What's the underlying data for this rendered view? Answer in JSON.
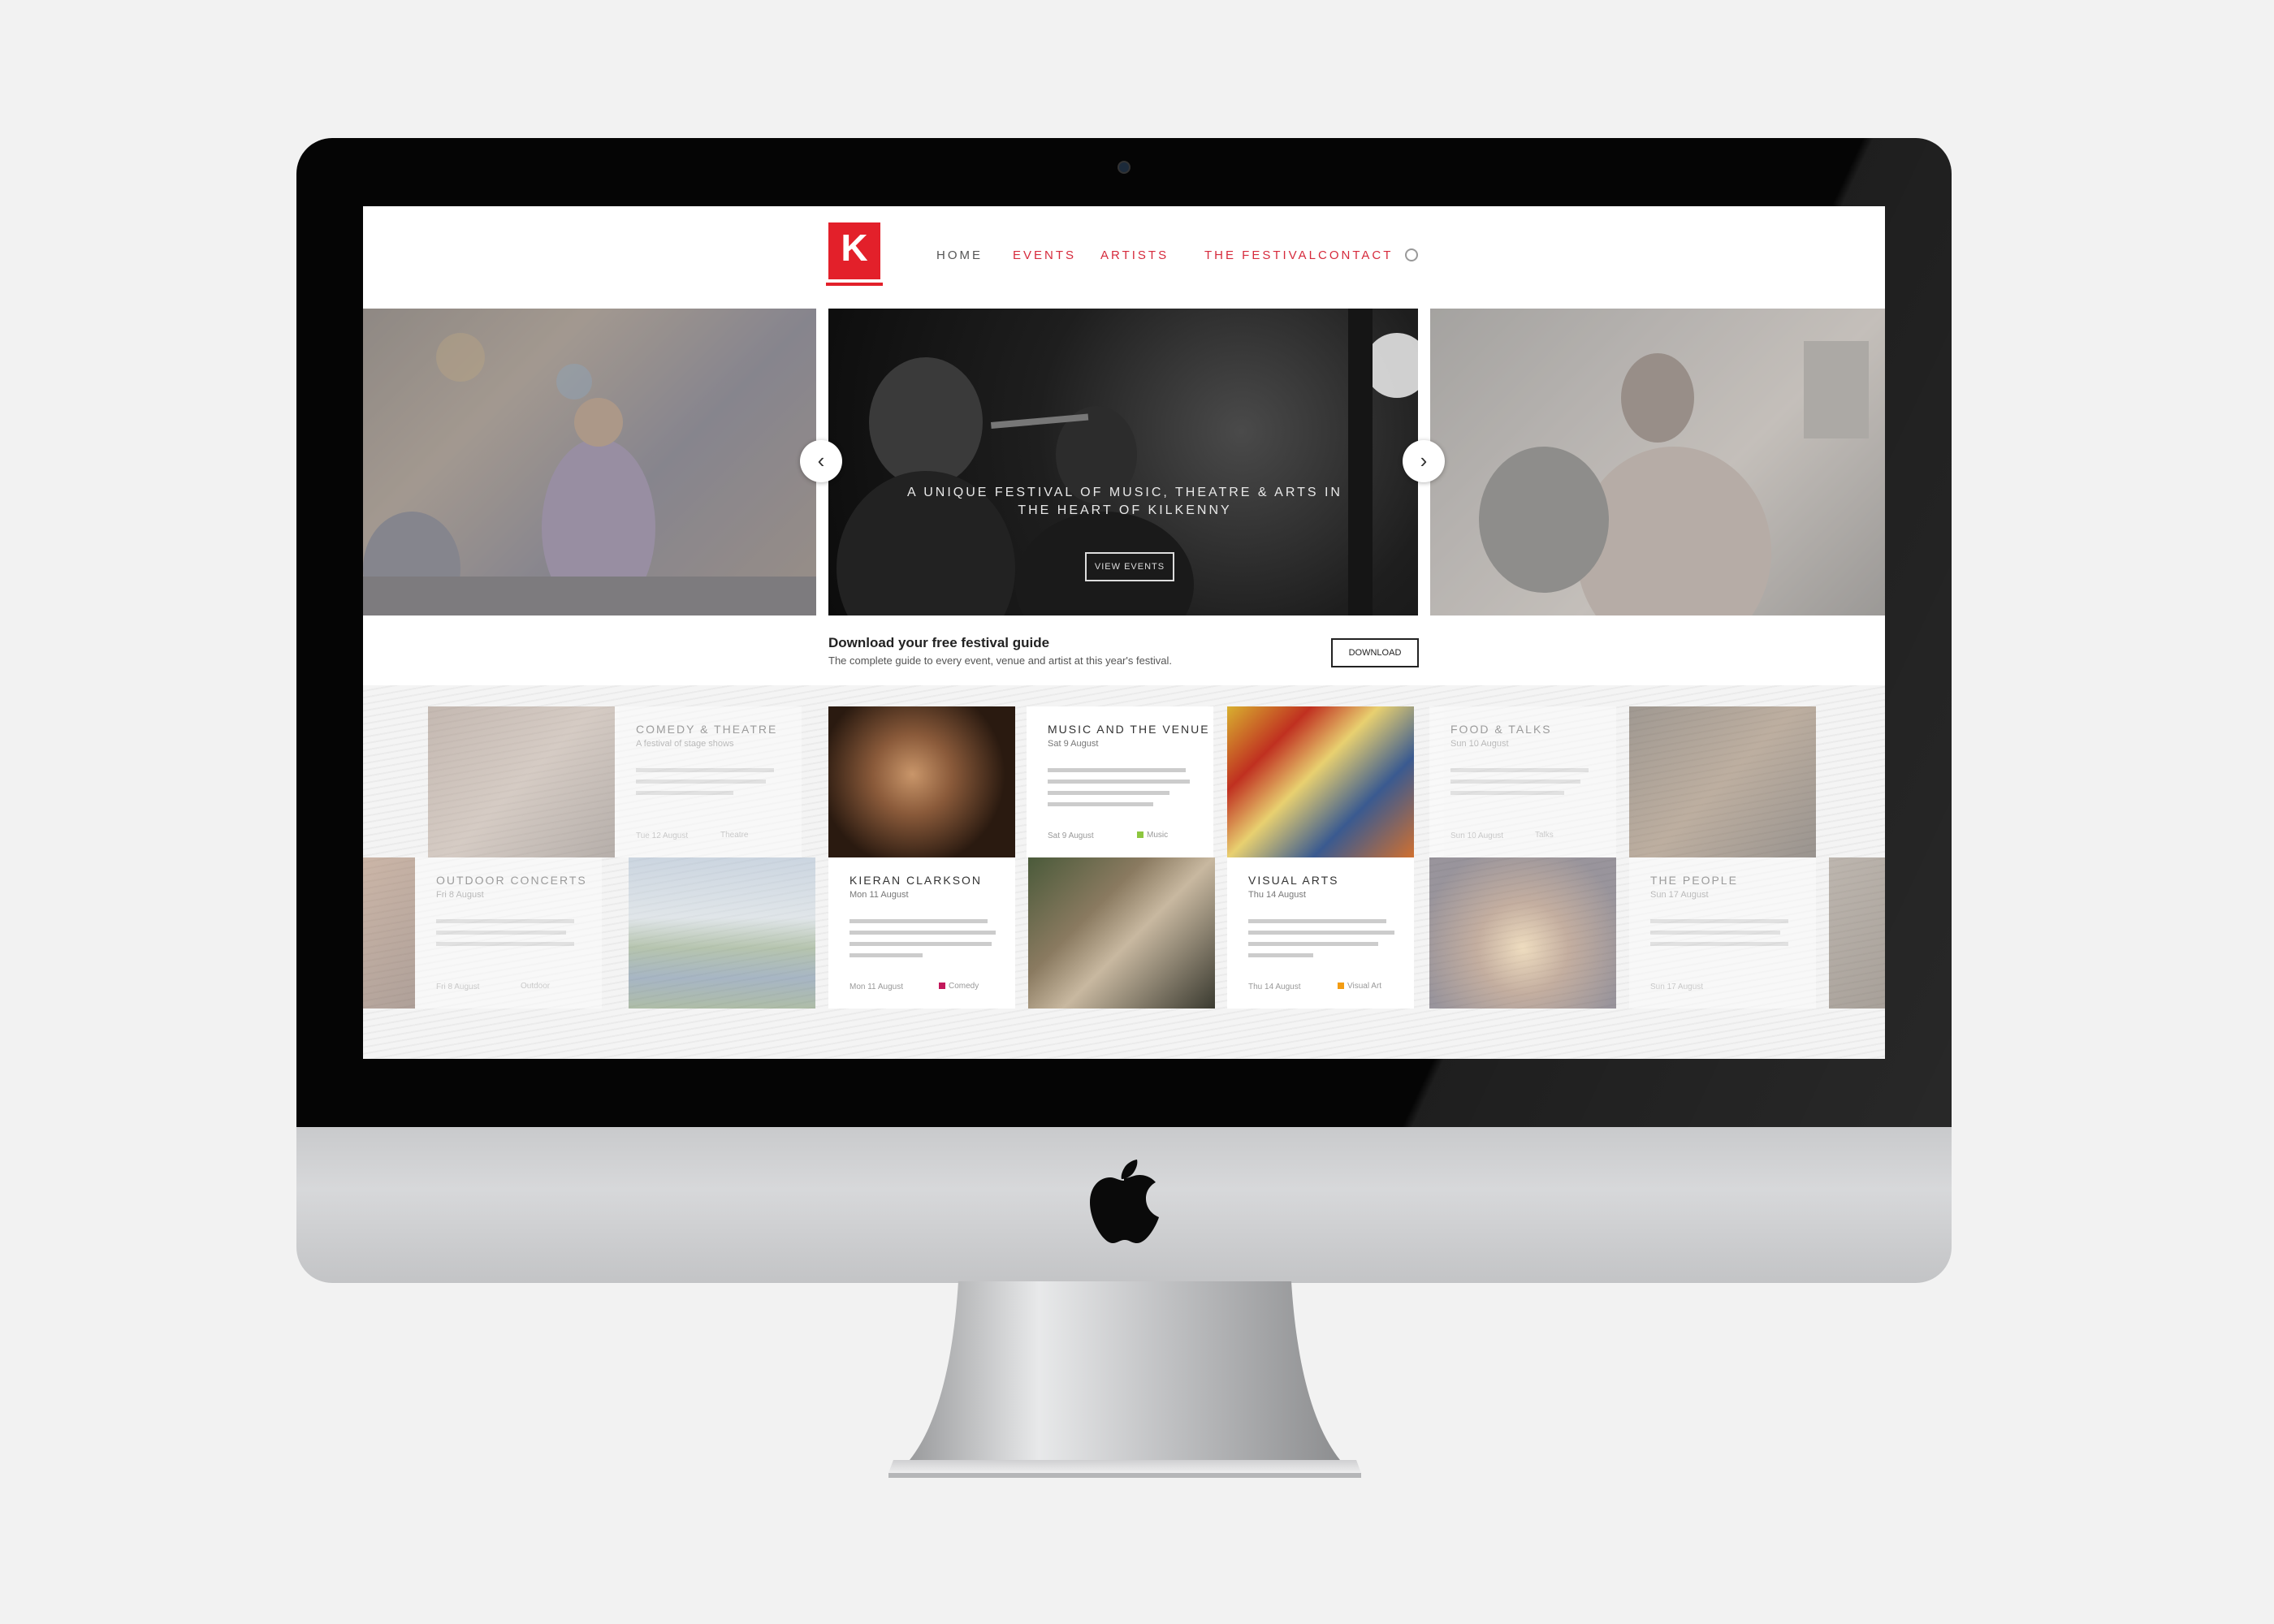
{
  "nav": {
    "logo_letter": "K",
    "items": [
      "HOME",
      "EVENTS",
      "ARTISTS",
      "THE FESTIVAL",
      "CONTACT"
    ]
  },
  "hero": {
    "caption": "A UNIQUE FESTIVAL OF MUSIC, THEATRE & ARTS IN THE HEART OF KILKENNY",
    "button": "VIEW EVENTS",
    "prev_label": "‹",
    "next_label": "›"
  },
  "promo": {
    "title": "Download your free festival guide",
    "subtitle": "The complete guide to every event, venue and artist at this year's festival.",
    "button": "DOWNLOAD"
  },
  "cards": [
    {
      "title": "COMEDY & THEATRE",
      "subtitle": "A festival of stage shows",
      "meta": "Tue 12 August",
      "tag": "Theatre"
    },
    {
      "title": "MUSIC AND THE VENUE",
      "subtitle": "Sat 9 August",
      "meta": "Sat 9 August",
      "tag": "Music"
    },
    {
      "title": "FOOD & TALKS",
      "subtitle": "Sun 10 August",
      "meta": "Sun 10 August",
      "tag": "Talks"
    },
    {
      "title": "OUTDOOR CONCERTS",
      "subtitle": "Fri 8 August",
      "meta": "Fri 8 August",
      "tag": "Outdoor"
    },
    {
      "title": "KIERAN CLARKSON",
      "subtitle": "Mon 11 August",
      "meta": "Mon 11 August",
      "tag": "Comedy"
    },
    {
      "title": "VISUAL ARTS",
      "subtitle": "Thu 14 August",
      "meta": "Thu 14 August",
      "tag": "Visual Art"
    },
    {
      "title": "THE PEOPLE",
      "subtitle": "Sun 17 August",
      "meta": "Sun 17 August",
      "tag": ""
    }
  ],
  "colors": {
    "accent": "#e3202a",
    "nav_text": "#d62a3c",
    "tag_green": "#8dc63f",
    "tag_magenta": "#c2185b",
    "tag_orange": "#f39c12"
  },
  "icons": [
    "search-icon",
    "apple-icon",
    "chevron-left-icon",
    "chevron-right-icon"
  ]
}
